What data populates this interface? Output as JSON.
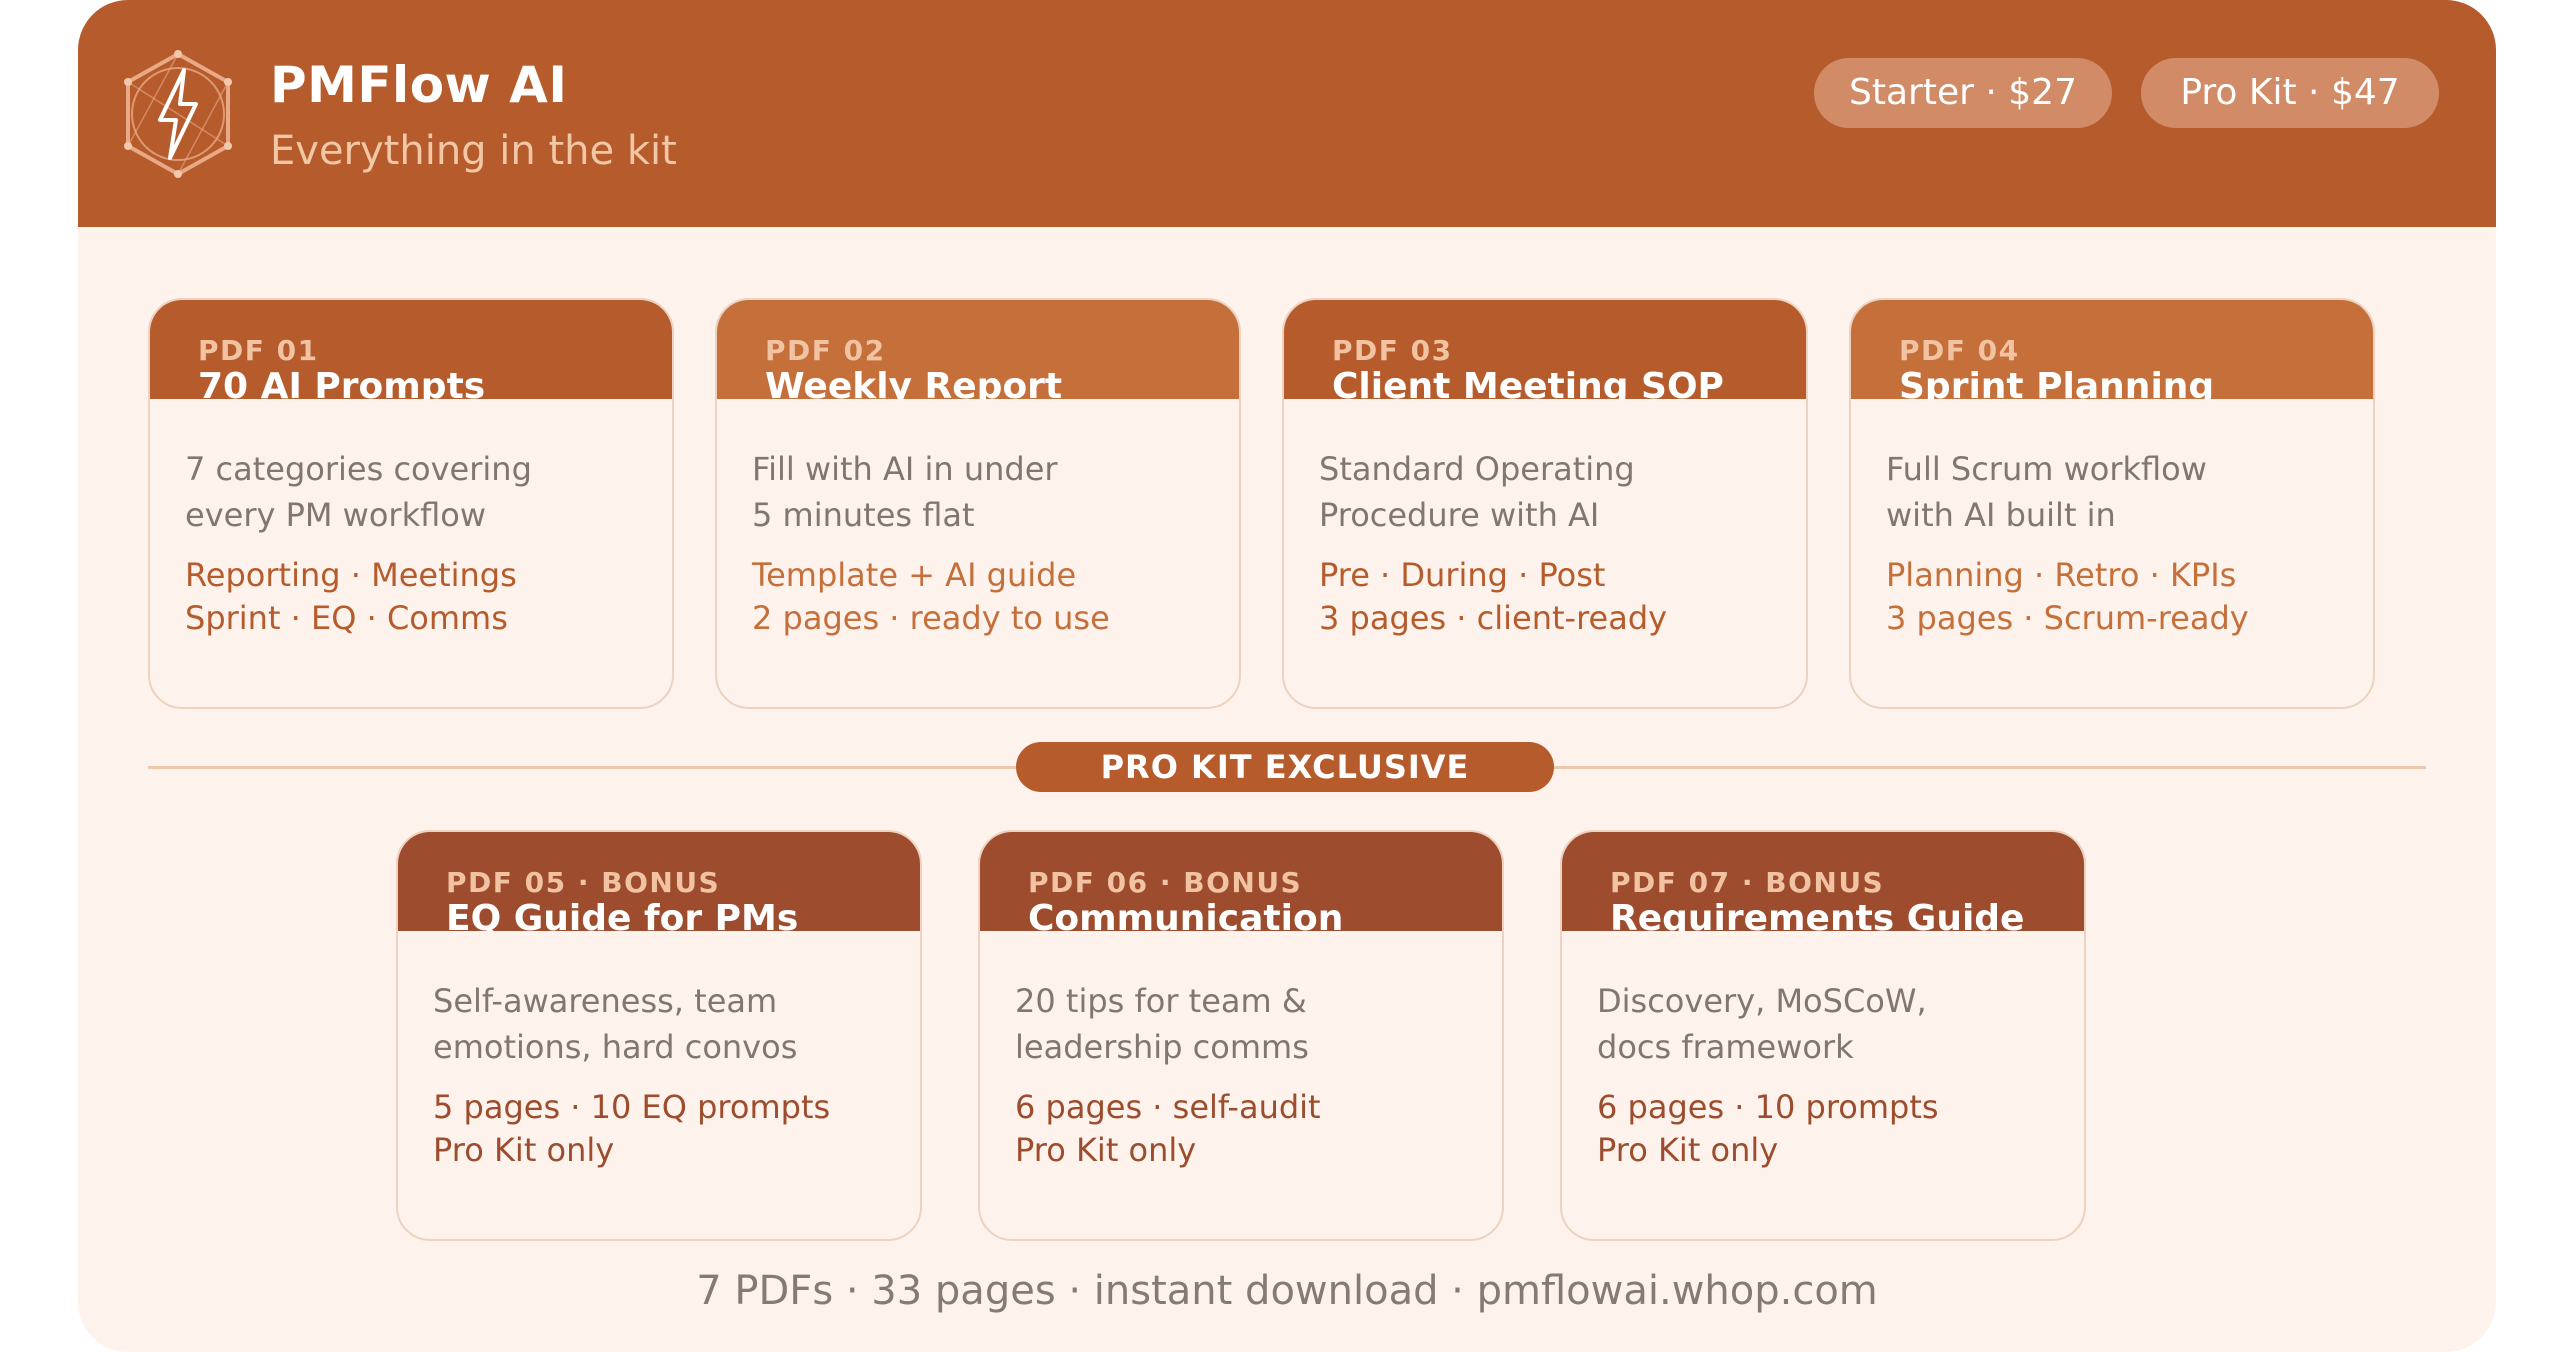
{
  "header": {
    "brand_name": "PMFlow AI",
    "tagline": "Everything in the kit",
    "pills": [
      {
        "label": "Starter · $27"
      },
      {
        "label": "Pro Kit · $47"
      }
    ]
  },
  "core_pdfs": [
    {
      "num": "PDF 01",
      "title": "70 AI Prompts",
      "desc_1": "7 categories covering",
      "desc_2": "every PM workflow",
      "meta_1": "Reporting · Meetings",
      "meta_2": "Sprint · EQ · Comms",
      "head_color": "#b65b2c",
      "meta_color": "#b65b2c"
    },
    {
      "num": "PDF 02",
      "title": "Weekly Report",
      "desc_1": "Fill with AI in under",
      "desc_2": "5 minutes flat",
      "meta_1": "Template + AI guide",
      "meta_2": "2 pages · ready to use",
      "head_color": "#c56f3a",
      "meta_color": "#c56f3a"
    },
    {
      "num": "PDF 03",
      "title": "Client Meeting SOP",
      "desc_1": "Standard Operating",
      "desc_2": "Procedure with AI",
      "meta_1": "Pre · During · Post",
      "meta_2": "3 pages · client-ready",
      "head_color": "#b65b2c",
      "meta_color": "#b65b2c"
    },
    {
      "num": "PDF 04",
      "title": "Sprint Planning",
      "desc_1": "Full Scrum workflow",
      "desc_2": "with AI built in",
      "meta_1": "Planning · Retro · KPIs",
      "meta_2": "3 pages · Scrum-ready",
      "head_color": "#c56f3a",
      "meta_color": "#c56f3a"
    }
  ],
  "exclusive_label": "PRO KIT EXCLUSIVE",
  "bonus_pdfs": [
    {
      "num": "PDF 05 · BONUS",
      "title": "EQ Guide for PMs",
      "desc_1": "Self-awareness, team",
      "desc_2": "emotions, hard convos",
      "meta_1": "5 pages · 10 EQ prompts",
      "meta_2": "Pro Kit only",
      "head_color": "#9d4d2e",
      "meta_color": "#9d4d2e"
    },
    {
      "num": "PDF 06 · BONUS",
      "title": "Communication",
      "desc_1": "20 tips for team &",
      "desc_2": "leadership comms",
      "meta_1": "6 pages · self-audit",
      "meta_2": "Pro Kit only",
      "head_color": "#9d4d2e",
      "meta_color": "#9d4d2e"
    },
    {
      "num": "PDF 07 · BONUS",
      "title": "Requirements Guide",
      "desc_1": "Discovery, MoSCoW,",
      "desc_2": "docs framework",
      "meta_1": "6 pages · 10 prompts",
      "meta_2": "Pro Kit only",
      "head_color": "#9d4d2e",
      "meta_color": "#9d4d2e"
    }
  ],
  "footer": "7 PDFs · 33 pages · instant download · pmflowai.whop.com",
  "icons": {
    "logo": "lightning-hexagon-icon"
  },
  "colors": {
    "brand": "#b65b2c",
    "panel_bg": "#fdf3ec"
  }
}
